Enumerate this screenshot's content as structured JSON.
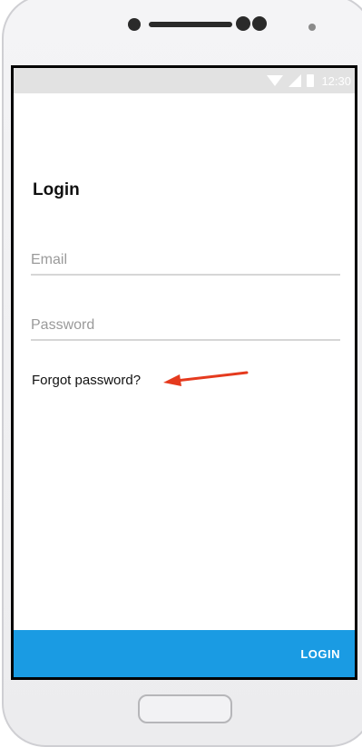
{
  "status_bar": {
    "time": "12:30",
    "icons": [
      "wifi-icon",
      "signal-icon",
      "battery-icon"
    ]
  },
  "screen": {
    "title": "Login",
    "email": {
      "value": "",
      "placeholder": "Email"
    },
    "password": {
      "value": "",
      "placeholder": "Password"
    },
    "forgot_password_label": "Forgot password?",
    "login_label": "LOGIN"
  },
  "colors": {
    "accent": "#1a9be3",
    "annotation_arrow": "#e53a1e",
    "status_bar": "#e2e2e2"
  }
}
